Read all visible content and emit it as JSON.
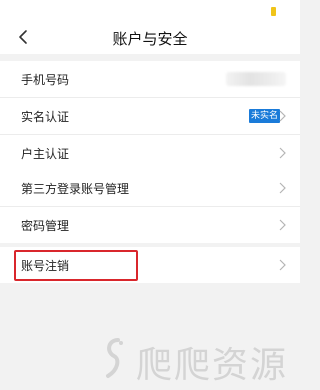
{
  "nav": {
    "title": "账户与安全"
  },
  "groups": [
    {
      "rows": [
        {
          "label": "手机号码",
          "value_masked": true
        },
        {
          "label": "实名认证",
          "badge": "未实名"
        },
        {
          "label": "户主认证"
        }
      ]
    },
    {
      "rows": [
        {
          "label": "第三方登录账号管理"
        },
        {
          "label": "密码管理"
        }
      ]
    },
    {
      "rows": [
        {
          "label": "账号注销",
          "highlighted": true
        }
      ]
    }
  ],
  "colors": {
    "background": "#f2f2f2",
    "card": "#ffffff",
    "badge_bg": "#1a7bd9",
    "highlight_border": "#d9262c",
    "battery": "#f0c419"
  },
  "icons": {
    "back": "chevron-left-icon",
    "row_arrow": "chevron-right-icon",
    "battery": "battery-icon"
  },
  "watermark": {
    "text": "爬爬资源"
  }
}
